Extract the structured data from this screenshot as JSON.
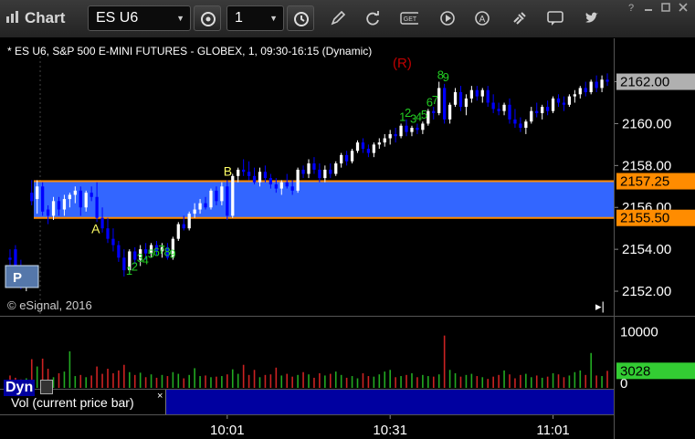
{
  "app": {
    "title": "Chart",
    "symbol": "ES U6",
    "interval": "1",
    "icons": [
      "settings-icon",
      "clock-icon",
      "pencil-icon",
      "refresh-icon",
      "get-icon",
      "play-icon",
      "alert-icon",
      "link-icon",
      "comment-icon",
      "twitter-icon",
      "help-icon",
      "minimize-icon",
      "maximize-icon",
      "close-icon"
    ]
  },
  "chart": {
    "title": "* ES U6, S&P 500 E-MINI FUTURES - GLOBEX, 1, 09:30-16:15 (Dynamic)",
    "r_marker": "(R)",
    "copyright": "© eSignal, 2016",
    "zone_label_a": "A",
    "zone_label_b": "B",
    "nav_end": "▸|",
    "ticker_badge": "P"
  },
  "chart_data": {
    "type": "candlestick",
    "price_axis_ticks": [
      "2152.00",
      "2154.00",
      "2156.00",
      "2158.00",
      "2160.00",
      "2162.00"
    ],
    "price_range": [
      2151.0,
      2163.2
    ],
    "last_price_label": "2162.00",
    "zone_high_label": "2157.25",
    "zone_low_label": "2155.50",
    "zone_high": 2157.25,
    "zone_low": 2155.5,
    "time_ticks": [
      "10:01",
      "10:31",
      "11:01"
    ],
    "volume_axis_ticks": [
      "10000",
      "0"
    ],
    "volume_last_label": "3028",
    "volume_legend": "Vol (current price bar)",
    "setup_counts": {
      "buy_low": [
        "1",
        "2",
        "3",
        "4",
        "5",
        "6",
        "7",
        "8",
        "9"
      ],
      "buy_high": [
        "1",
        "2",
        "3",
        "4",
        "5",
        "6",
        "7",
        "8",
        "9"
      ]
    },
    "colors": {
      "up_candle": "#ffffff",
      "down_candle": "#0000ff",
      "zone_fill": "#3366ff",
      "zone_line": "#ff8c00",
      "last_price_bg": "#b0b0b0",
      "zone_label_bg": "#ff8c00",
      "volume_up": "#22aa22",
      "volume_down": "#cc2222",
      "volume_last_bg": "#33cc33",
      "setup_text": "#22cc22",
      "r_marker": "#c00000",
      "zone_text": "#ffff66"
    },
    "bars": [
      [
        2153.6,
        2154.0,
        2153.2,
        2153.5
      ],
      [
        2154.0,
        2154.2,
        2153.0,
        2153.2
      ],
      [
        2153.2,
        2153.5,
        2152.1,
        2152.4
      ],
      [
        2152.4,
        2153.0,
        2152.0,
        2152.6
      ],
      [
        2156.7,
        2157.3,
        2156.1,
        2156.3
      ],
      [
        2156.4,
        2157.3,
        2155.7,
        2157.0
      ],
      [
        2157.0,
        2157.2,
        2155.6,
        2155.8
      ],
      [
        2155.9,
        2156.1,
        2155.2,
        2155.6
      ],
      [
        2155.6,
        2156.5,
        2155.4,
        2156.3
      ],
      [
        2156.3,
        2156.5,
        2155.6,
        2155.9
      ],
      [
        2155.9,
        2156.6,
        2155.6,
        2156.4
      ],
      [
        2156.4,
        2156.7,
        2156.0,
        2156.6
      ],
      [
        2156.6,
        2157.0,
        2156.2,
        2156.8
      ],
      [
        2156.8,
        2157.0,
        2155.6,
        2156.0
      ],
      [
        2156.0,
        2156.8,
        2155.8,
        2156.7
      ],
      [
        2156.7,
        2157.0,
        2156.3,
        2156.5
      ],
      [
        2156.5,
        2157.2,
        2155.3,
        2155.5
      ],
      [
        2155.5,
        2156.0,
        2154.8,
        2155.0
      ],
      [
        2155.0,
        2155.5,
        2154.3,
        2154.5
      ],
      [
        2154.5,
        2155.0,
        2153.9,
        2154.2
      ],
      [
        2154.2,
        2154.4,
        2153.4,
        2153.6
      ],
      [
        2153.6,
        2154.0,
        2152.7,
        2153.0
      ],
      [
        2153.0,
        2154.0,
        2152.9,
        2153.9
      ],
      [
        2153.9,
        2154.1,
        2153.3,
        2153.5
      ],
      [
        2153.5,
        2154.2,
        2153.2,
        2154.0
      ],
      [
        2154.0,
        2154.3,
        2153.5,
        2153.8
      ],
      [
        2153.8,
        2154.3,
        2153.6,
        2154.2
      ],
      [
        2154.2,
        2154.4,
        2153.7,
        2153.9
      ],
      [
        2153.9,
        2154.3,
        2153.6,
        2154.1
      ],
      [
        2154.1,
        2154.3,
        2153.5,
        2153.6
      ],
      [
        2153.6,
        2154.6,
        2153.5,
        2154.5
      ],
      [
        2154.5,
        2155.3,
        2154.4,
        2155.2
      ],
      [
        2155.2,
        2155.6,
        2154.9,
        2155.0
      ],
      [
        2155.0,
        2155.8,
        2154.9,
        2155.7
      ],
      [
        2155.7,
        2156.2,
        2155.5,
        2155.9
      ],
      [
        2155.9,
        2156.4,
        2155.7,
        2156.2
      ],
      [
        2156.2,
        2156.5,
        2155.9,
        2156.0
      ],
      [
        2156.0,
        2156.9,
        2155.9,
        2156.8
      ],
      [
        2156.8,
        2157.0,
        2156.1,
        2156.3
      ],
      [
        2156.3,
        2157.2,
        2156.1,
        2157.0
      ],
      [
        2157.0,
        2157.3,
        2155.4,
        2155.6
      ],
      [
        2155.6,
        2157.6,
        2155.5,
        2157.5
      ],
      [
        2157.5,
        2157.9,
        2157.2,
        2157.8
      ],
      [
        2157.8,
        2158.3,
        2157.5,
        2157.7
      ],
      [
        2157.7,
        2158.2,
        2157.3,
        2157.5
      ],
      [
        2157.5,
        2157.9,
        2157.1,
        2157.2
      ],
      [
        2157.2,
        2157.9,
        2157.0,
        2157.7
      ],
      [
        2157.7,
        2158.0,
        2157.2,
        2157.4
      ],
      [
        2157.4,
        2157.6,
        2156.9,
        2157.1
      ],
      [
        2157.1,
        2157.4,
        2156.7,
        2156.9
      ],
      [
        2156.9,
        2157.3,
        2156.6,
        2157.2
      ],
      [
        2157.2,
        2157.6,
        2156.9,
        2157.0
      ],
      [
        2157.0,
        2157.3,
        2156.6,
        2156.8
      ],
      [
        2156.8,
        2157.9,
        2156.7,
        2157.8
      ],
      [
        2157.8,
        2158.0,
        2157.4,
        2157.6
      ],
      [
        2157.6,
        2158.3,
        2157.4,
        2158.1
      ],
      [
        2158.1,
        2158.4,
        2157.6,
        2157.8
      ],
      [
        2157.8,
        2158.1,
        2157.2,
        2157.4
      ],
      [
        2157.4,
        2158.0,
        2157.2,
        2157.8
      ],
      [
        2157.8,
        2158.1,
        2157.4,
        2157.6
      ],
      [
        2157.6,
        2158.2,
        2157.5,
        2158.1
      ],
      [
        2158.1,
        2158.6,
        2157.9,
        2158.5
      ],
      [
        2158.5,
        2158.7,
        2158.0,
        2158.2
      ],
      [
        2158.2,
        2158.8,
        2158.1,
        2158.7
      ],
      [
        2158.7,
        2159.2,
        2158.6,
        2159.1
      ],
      [
        2159.1,
        2159.3,
        2158.6,
        2158.8
      ],
      [
        2158.8,
        2159.0,
        2158.4,
        2158.6
      ],
      [
        2158.6,
        2159.1,
        2158.4,
        2159.0
      ],
      [
        2159.0,
        2159.3,
        2158.8,
        2159.1
      ],
      [
        2159.1,
        2159.5,
        2158.9,
        2159.3
      ],
      [
        2159.3,
        2159.7,
        2159.0,
        2159.5
      ],
      [
        2159.5,
        2159.8,
        2159.1,
        2159.4
      ],
      [
        2159.4,
        2160.0,
        2159.3,
        2159.9
      ],
      [
        2159.9,
        2160.2,
        2159.4,
        2159.6
      ],
      [
        2159.6,
        2159.9,
        2159.4,
        2159.8
      ],
      [
        2159.8,
        2160.0,
        2159.5,
        2159.7
      ],
      [
        2159.7,
        2160.1,
        2159.5,
        2160.0
      ],
      [
        2160.0,
        2160.7,
        2159.9,
        2160.6
      ],
      [
        2160.6,
        2160.8,
        2160.2,
        2160.5
      ],
      [
        2160.5,
        2162.0,
        2160.4,
        2161.7
      ],
      [
        2161.7,
        2161.9,
        2160.0,
        2160.2
      ],
      [
        2160.2,
        2161.0,
        2160.0,
        2160.9
      ],
      [
        2160.9,
        2161.7,
        2160.8,
        2161.5
      ],
      [
        2161.5,
        2161.8,
        2160.6,
        2160.8
      ],
      [
        2160.8,
        2161.4,
        2160.4,
        2161.2
      ],
      [
        2161.2,
        2161.8,
        2161.0,
        2161.6
      ],
      [
        2161.6,
        2161.8,
        2161.1,
        2161.3
      ],
      [
        2161.3,
        2161.7,
        2161.0,
        2161.6
      ],
      [
        2161.6,
        2161.8,
        2160.8,
        2161.0
      ],
      [
        2161.0,
        2161.4,
        2160.5,
        2160.7
      ],
      [
        2160.7,
        2161.0,
        2160.4,
        2160.6
      ],
      [
        2160.6,
        2161.0,
        2160.4,
        2160.9
      ],
      [
        2160.9,
        2161.2,
        2160.0,
        2160.2
      ],
      [
        2160.2,
        2160.7,
        2159.8,
        2160.0
      ],
      [
        2160.0,
        2160.3,
        2159.6,
        2159.8
      ],
      [
        2159.8,
        2160.2,
        2159.5,
        2160.1
      ],
      [
        2160.1,
        2160.8,
        2160.0,
        2160.6
      ],
      [
        2160.6,
        2161.0,
        2160.3,
        2160.5
      ],
      [
        2160.5,
        2160.9,
        2160.2,
        2160.8
      ],
      [
        2160.8,
        2161.1,
        2160.4,
        2160.6
      ],
      [
        2160.6,
        2161.3,
        2160.5,
        2161.2
      ],
      [
        2161.2,
        2161.4,
        2160.8,
        2161.0
      ],
      [
        2161.0,
        2161.3,
        2160.6,
        2160.9
      ],
      [
        2160.9,
        2161.4,
        2160.8,
        2161.3
      ],
      [
        2161.3,
        2161.6,
        2161.0,
        2161.4
      ],
      [
        2161.4,
        2161.8,
        2161.2,
        2161.7
      ],
      [
        2161.7,
        2162.0,
        2161.3,
        2161.5
      ],
      [
        2161.5,
        2162.1,
        2161.4,
        2162.0
      ],
      [
        2162.0,
        2162.3,
        2161.5,
        2161.7
      ],
      [
        2161.7,
        2162.3,
        2161.5,
        2162.1
      ],
      [
        2162.1,
        2162.4,
        2161.8,
        2162.0
      ]
    ],
    "volume": [
      2200,
      1800,
      1500,
      1700,
      5100,
      3800,
      5200,
      3400,
      1900,
      2600,
      2900,
      6500,
      2100,
      2300,
      1900,
      2200,
      3800,
      2500,
      3400,
      2600,
      3100,
      4100,
      2800,
      2300,
      2700,
      1900,
      2400,
      1800,
      2300,
      2100,
      2800,
      2500,
      1700,
      2300,
      3500,
      2100,
      2200,
      1900,
      2000,
      2100,
      2400,
      3300,
      2500,
      4100,
      2300,
      3200,
      1900,
      2300,
      2400,
      3600,
      2200,
      2500,
      2000,
      2300,
      2800,
      2400,
      1800,
      2600,
      2200,
      2500,
      2900,
      2300,
      1800,
      2100,
      1700,
      2600,
      2100,
      2000,
      2400,
      2900,
      3200,
      1900,
      2100,
      2300,
      2600,
      1900,
      2300,
      2100,
      2000,
      2400,
      9300,
      3200,
      2600,
      2000,
      2300,
      2500,
      2100,
      1900,
      1600,
      2000,
      2300,
      3100,
      2400,
      1700,
      2300,
      2500,
      1900,
      2200,
      1800,
      2000,
      2600,
      2400,
      1900,
      2200,
      2800,
      3100,
      2300,
      6200,
      2200,
      2100,
      3028
    ]
  },
  "status": {
    "mode_label": "Dyn"
  }
}
